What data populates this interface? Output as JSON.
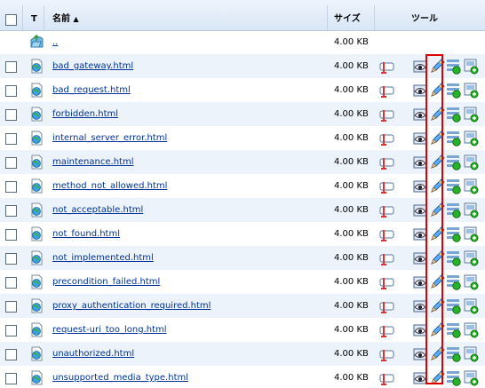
{
  "header": {
    "type_label": "T",
    "name_label": "名前",
    "sort_arrow": "▲",
    "size_label": "サイズ",
    "tools_label": "ツール"
  },
  "parent_row": {
    "name": "..",
    "size": "4.00 KB",
    "icon": "parent-folder-icon"
  },
  "files": [
    {
      "name": "bad_gateway.html",
      "size": "4.00 KB"
    },
    {
      "name": "bad_request.html",
      "size": "4.00 KB"
    },
    {
      "name": "forbidden.html",
      "size": "4.00 KB"
    },
    {
      "name": "internal_server_error.html",
      "size": "4.00 KB"
    },
    {
      "name": "maintenance.html",
      "size": "4.00 KB"
    },
    {
      "name": "method_not_allowed.html",
      "size": "4.00 KB"
    },
    {
      "name": "not_acceptable.html",
      "size": "4.00 KB"
    },
    {
      "name": "not_found.html",
      "size": "4.00 KB"
    },
    {
      "name": "not_implemented.html",
      "size": "4.00 KB"
    },
    {
      "name": "precondition_failed.html",
      "size": "4.00 KB"
    },
    {
      "name": "proxy_authentication_required.html",
      "size": "4.00 KB"
    },
    {
      "name": "request-uri_too_long.html",
      "size": "4.00 KB"
    },
    {
      "name": "unauthorized.html",
      "size": "4.00 KB"
    },
    {
      "name": "unsupported_media_type.html",
      "size": "4.00 KB"
    }
  ],
  "tool_icons": [
    "rename-icon",
    "view-icon",
    "edit-icon",
    "properties-icon",
    "copy-icon"
  ],
  "colors": {
    "header_bg": "#dde8f6",
    "alt_row_bg": "#edf3fb",
    "link": "#003399",
    "highlight": "#e00000"
  }
}
